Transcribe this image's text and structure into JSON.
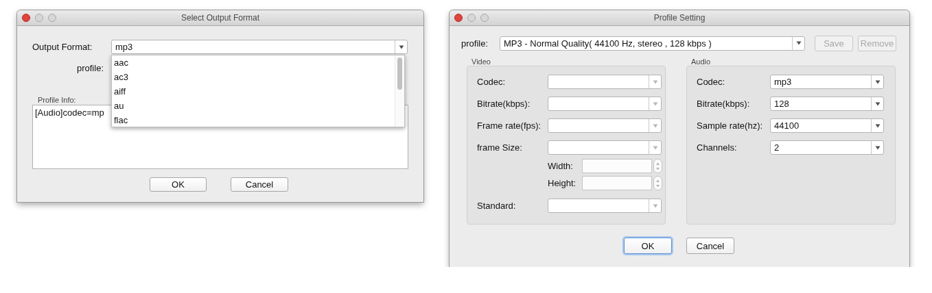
{
  "select_output_format": {
    "title": "Select Output Format",
    "output_format": {
      "label": "Output Format:",
      "value": "mp3",
      "expanded": true
    },
    "profile": {
      "label": "profile:"
    },
    "format_options": [
      {
        "label": "aac",
        "selected": false
      },
      {
        "label": "ac3",
        "selected": false
      },
      {
        "label": "aiff",
        "selected": false
      },
      {
        "label": "au",
        "selected": false
      },
      {
        "label": "flac",
        "selected": false
      }
    ],
    "profile_info": {
      "label": "Profile Info:",
      "text": "[Audio]codec=mp"
    },
    "buttons": [
      {
        "label": "OK",
        "default": false
      },
      {
        "label": "Cancel",
        "default": false
      }
    ]
  },
  "profile_setting": {
    "title": "Profile Setting",
    "profile": {
      "label": "profile:",
      "value": "MP3 - Normal Quality( 44100 Hz, stereo , 128 kbps )"
    },
    "actions": [
      {
        "label": "Save",
        "disabled": true
      },
      {
        "label": "Remove",
        "disabled": true
      }
    ],
    "video": {
      "title": "Video",
      "fields": [
        {
          "kind": "combo",
          "label": "Codec:",
          "disabled": true
        },
        {
          "kind": "combo",
          "label": "Bitrate(kbps):",
          "disabled": true
        },
        {
          "kind": "combo",
          "label": "Frame rate(fps):",
          "disabled": true
        },
        {
          "kind": "combo",
          "label": "frame Size:",
          "disabled": true
        },
        {
          "kind": "spinner",
          "label": "Width:",
          "disabled": true
        },
        {
          "kind": "spinner",
          "label": "Height:",
          "disabled": true
        },
        {
          "kind": "combo",
          "label": "Standard:",
          "disabled": true
        }
      ]
    },
    "audio": {
      "title": "Audio",
      "fields": [
        {
          "kind": "combo",
          "label": "Codec:",
          "value": "mp3",
          "disabled": false
        },
        {
          "kind": "combo",
          "label": "Bitrate(kbps):",
          "value": "128",
          "disabled": false
        },
        {
          "kind": "combo",
          "label": "Sample rate(hz):",
          "value": "44100",
          "disabled": false
        },
        {
          "kind": "combo",
          "label": "Channels:",
          "value": "2",
          "disabled": false
        }
      ]
    },
    "buttons": [
      {
        "label": "OK",
        "default": true
      },
      {
        "label": "Cancel",
        "default": false
      }
    ]
  }
}
